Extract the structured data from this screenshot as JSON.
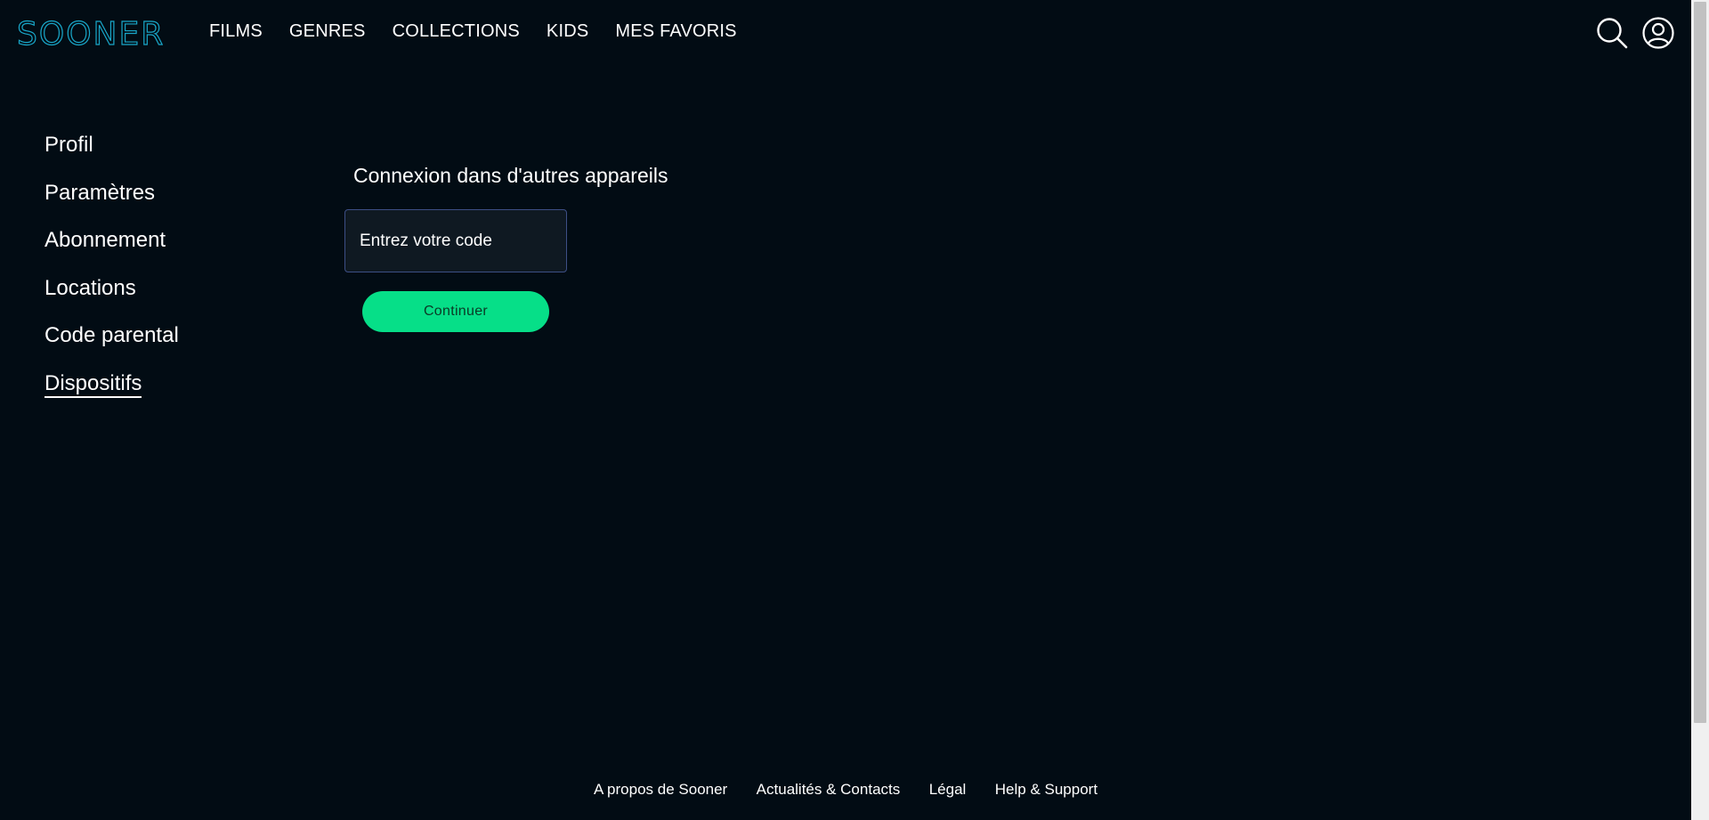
{
  "brand": {
    "logo_text": "SOONER",
    "accent_color": "#19a7c9"
  },
  "nav": {
    "items": [
      {
        "label": "FILMS"
      },
      {
        "label": "GENRES"
      },
      {
        "label": "COLLECTIONS"
      },
      {
        "label": "KIDS"
      },
      {
        "label": "MES FAVORIS"
      }
    ]
  },
  "header_icons": {
    "search": "search-icon",
    "account": "user-icon"
  },
  "sidebar": {
    "items": [
      {
        "label": "Profil"
      },
      {
        "label": "Paramètres"
      },
      {
        "label": "Abonnement"
      },
      {
        "label": "Locations"
      },
      {
        "label": "Code parental"
      },
      {
        "label": "Dispositifs",
        "active": true
      }
    ]
  },
  "main": {
    "title": "Connexion dans d'autres appareils",
    "code_input": {
      "placeholder": "Entrez votre code",
      "value": ""
    },
    "continue_label": "Continuer",
    "button_color": "#06df88"
  },
  "footer": {
    "links": [
      {
        "label": "A propos de Sooner"
      },
      {
        "label": "Actualités & Contacts"
      },
      {
        "label": "Légal"
      },
      {
        "label": "Help & Support"
      }
    ]
  },
  "colors": {
    "background": "#020c14",
    "input_border": "#3d4f85"
  }
}
